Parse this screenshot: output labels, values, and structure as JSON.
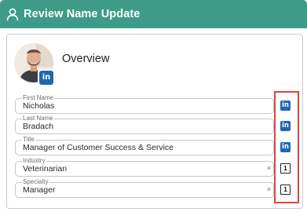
{
  "header": {
    "title": "Review Name Update",
    "icon": "person-icon"
  },
  "overview": {
    "title": "Overview"
  },
  "avatar_badge": {
    "text": "in",
    "icon": "linkedin-icon",
    "color": "#1f67b1"
  },
  "fields": [
    {
      "label": "First Name",
      "value": "Nicholas",
      "clear": "",
      "source": "in"
    },
    {
      "label": "Last Name",
      "value": "Bradach",
      "clear": "",
      "source": "in"
    },
    {
      "label": "Title",
      "value": "Manager of Customer Success & Service",
      "clear": "",
      "source": "in"
    },
    {
      "label": "Industry",
      "value": "Veterinarian",
      "clear": "×",
      "source": "1"
    },
    {
      "label": "Specialty",
      "value": "Manager",
      "clear": "×",
      "source": "1"
    }
  ],
  "colors": {
    "header": "#3d9b86",
    "highlight": "#e0443e",
    "linkedin": "#1f67b1"
  }
}
